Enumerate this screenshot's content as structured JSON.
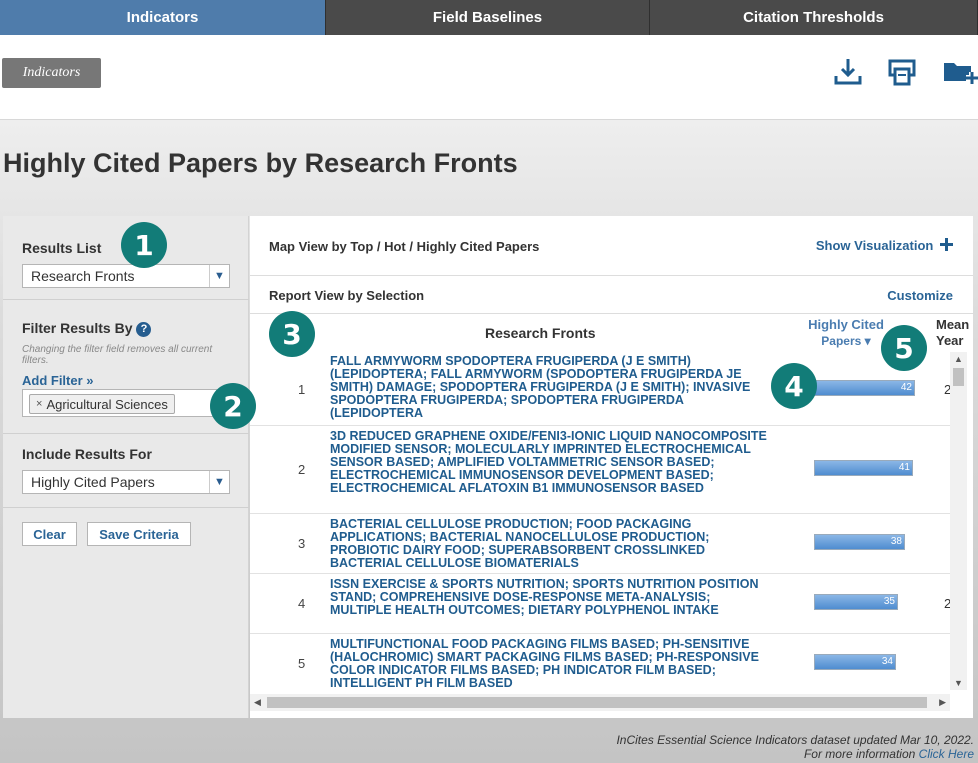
{
  "tabs": [
    {
      "label": "Indicators",
      "active": true
    },
    {
      "label": "Field Baselines",
      "active": false
    },
    {
      "label": "Citation Thresholds",
      "active": false
    }
  ],
  "breadcrumb": "Indicators",
  "page_title": "Highly Cited Papers by Research Fronts",
  "left": {
    "results_list_label": "Results List",
    "results_list_value": "Research Fronts",
    "filter_label": "Filter Results By",
    "help_glyph": "?",
    "filter_note": "Changing the filter field removes all current filters.",
    "add_filter": "Add Filter »",
    "chip_x": "×",
    "chip": "Agricultural Sciences",
    "include_label": "Include Results For",
    "include_value": "Highly Cited Papers",
    "clear": "Clear",
    "save": "Save Criteria"
  },
  "right": {
    "map_view": "Map View by Top / Hot / Highly Cited Papers",
    "show_vis": "Show Visualization",
    "report_view": "Report View by Selection",
    "customize": "Customize",
    "col_rf": "Research Fronts",
    "col_hcp_line1": "Highly Cited",
    "col_hcp_line2": "Papers ▾",
    "col_mean_line1": "Mean",
    "col_mean_line2": "Year"
  },
  "rows": [
    {
      "num": "1",
      "text": "FALL ARMYWORM SPODOPTERA FRUGIPERDA (J E SMITH) (LEPIDOPTERA; FALL ARMYWORM (SPODOPTERA FRUGIPERDA JE SMITH) DAMAGE; SPODOPTERA FRUGIPERDA (J E SMITH); INVASIVE SPODOPTERA FRUGIPERDA; SPODOPTERA FRUGIPERDA (LEPIDOPTERA",
      "value": 42,
      "year": "2"
    },
    {
      "num": "2",
      "text": "3D REDUCED GRAPHENE OXIDE/FENI3-IONIC LIQUID NANOCOMPOSITE MODIFIED SENSOR; MOLECULARLY IMPRINTED ELECTROCHEMICAL SENSOR BASED; AMPLIFIED VOLTAMMETRIC SENSOR BASED; ELECTROCHEMICAL IMMUNOSENSOR DEVELOPMENT BASED; ELECTROCHEMICAL AFLATOXIN B1 IMMUNOSENSOR BASED",
      "value": 41,
      "year": ""
    },
    {
      "num": "3",
      "text": "BACTERIAL CELLULOSE PRODUCTION; FOOD PACKAGING APPLICATIONS; BACTERIAL NANOCELLULOSE PRODUCTION; PROBIOTIC DAIRY FOOD; SUPERABSORBENT CROSSLINKED BACTERIAL CELLULOSE BIOMATERIALS",
      "value": 38,
      "year": ""
    },
    {
      "num": "4",
      "text": "ISSN EXERCISE & SPORTS NUTRITION; SPORTS NUTRITION POSITION STAND; COMPREHENSIVE DOSE-RESPONSE META-ANALYSIS; MULTIPLE HEALTH OUTCOMES; DIETARY POLYPHENOL INTAKE",
      "value": 35,
      "year": "2"
    },
    {
      "num": "5",
      "text": "MULTIFUNCTIONAL FOOD PACKAGING FILMS BASED; PH-SENSITIVE (HALOCHROMIC) SMART PACKAGING FILMS BASED; PH-RESPONSIVE COLOR INDICATOR FILMS BASED; PH INDICATOR FILM BASED; INTELLIGENT PH FILM BASED",
      "value": 34,
      "year": ""
    }
  ],
  "badges": [
    "1",
    "2",
    "3",
    "4",
    "5"
  ],
  "footer": {
    "line1": "InCites Essential Science Indicators dataset updated Mar 10, 2022.",
    "line2": "For more information ",
    "link": "Click Here"
  },
  "colors": {
    "accent": "#4f7cab",
    "badge": "#127c78",
    "link": "#2a6496"
  },
  "icons": [
    "download-icon",
    "print-icon",
    "add-to-folder-icon",
    "help-icon",
    "chevron-down-icon",
    "plus-icon"
  ]
}
